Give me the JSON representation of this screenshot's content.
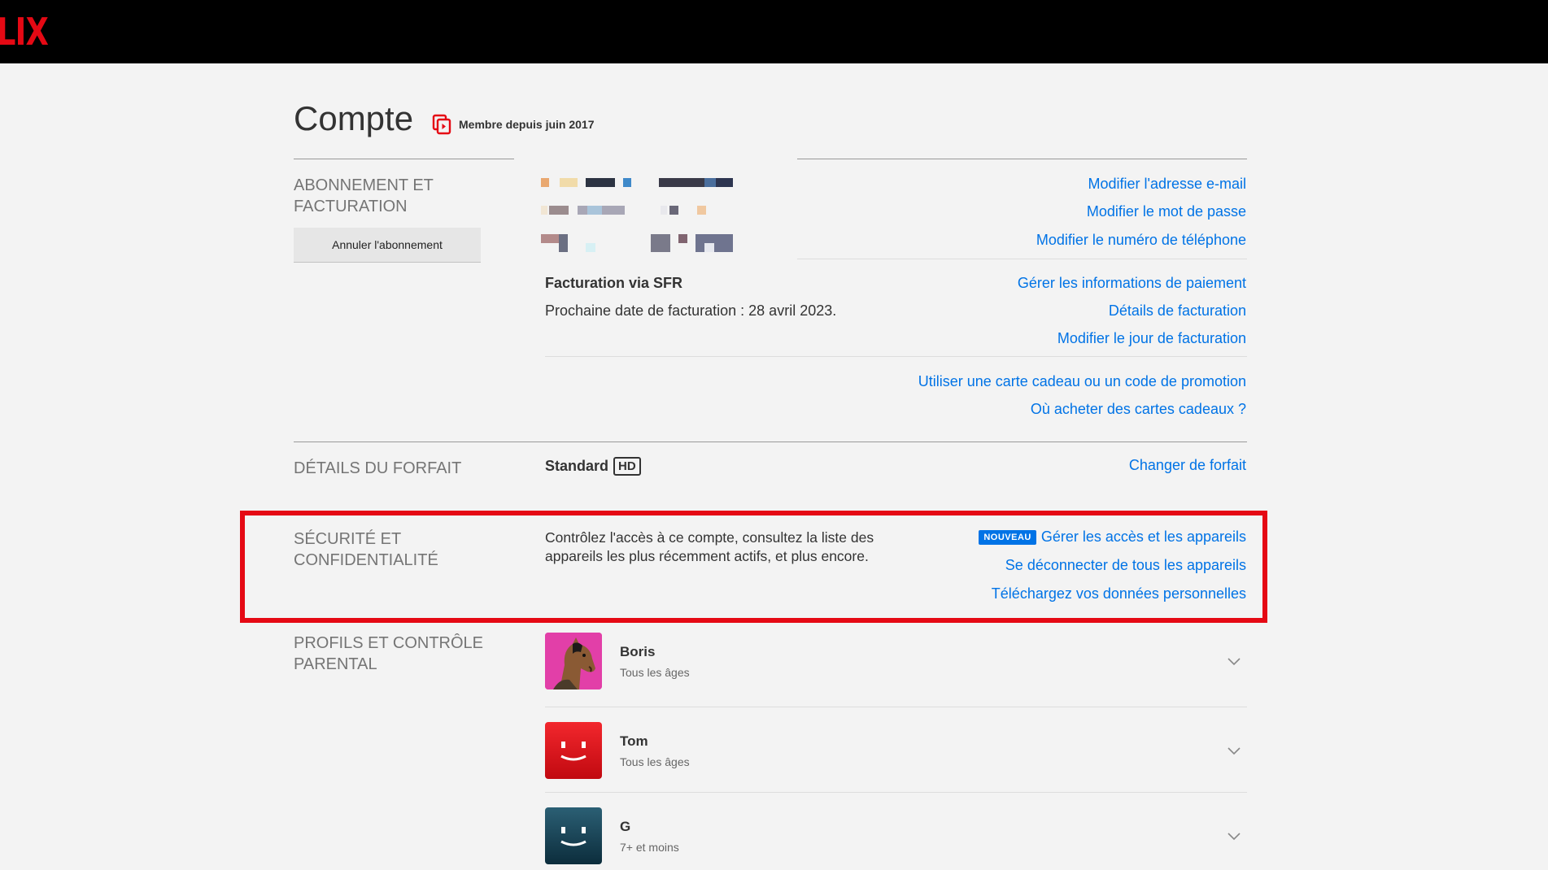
{
  "header": {
    "logo": "LIX"
  },
  "account": {
    "title": "Compte",
    "member_since": "Membre depuis juin 2017"
  },
  "billing": {
    "section_title": "ABONNEMENT ET FACTURATION",
    "cancel_button": "Annuler l'abonnement",
    "links_account": [
      "Modifier l'adresse e-mail",
      "Modifier le mot de passe",
      "Modifier le numéro de téléphone"
    ],
    "billed_via": "Facturation via SFR",
    "next_billing": "Prochaine date de facturation : 28 avril 2023.",
    "links_payment": [
      "Gérer les informations de paiement",
      "Détails de facturation",
      "Modifier le jour de facturation"
    ],
    "links_gift": [
      "Utiliser une carte cadeau ou un code de promotion",
      "Où acheter des cartes cadeaux ?"
    ]
  },
  "plan": {
    "section_title": "DÉTAILS DU FORFAIT",
    "name": "Standard",
    "badge": "HD",
    "change_link": "Changer de forfait"
  },
  "security": {
    "section_title": "SÉCURITÉ ET CONFIDENTIALITÉ",
    "description": "Contrôlez l'accès à ce compte, consultez la liste des appareils les plus récemment actifs, et plus encore.",
    "new_badge": "NOUVEAU",
    "links": [
      "Gérer les accès et les appareils",
      "Se déconnecter de tous les appareils",
      "Téléchargez vos données personnelles"
    ]
  },
  "profiles": {
    "section_title": "PROFILS ET CONTRÔLE PARENTAL",
    "items": [
      {
        "name": "Boris",
        "rating": "Tous les âges",
        "avatar": "bojack-avatar"
      },
      {
        "name": "Tom",
        "rating": "Tous les âges",
        "avatar": "red-smile-avatar"
      },
      {
        "name": "G",
        "rating": "7+ et moins",
        "avatar": "teal-smile-avatar"
      }
    ]
  },
  "colors": {
    "brand_red": "#e50914",
    "link_blue": "#0073e6",
    "background": "#f3f3f3"
  }
}
